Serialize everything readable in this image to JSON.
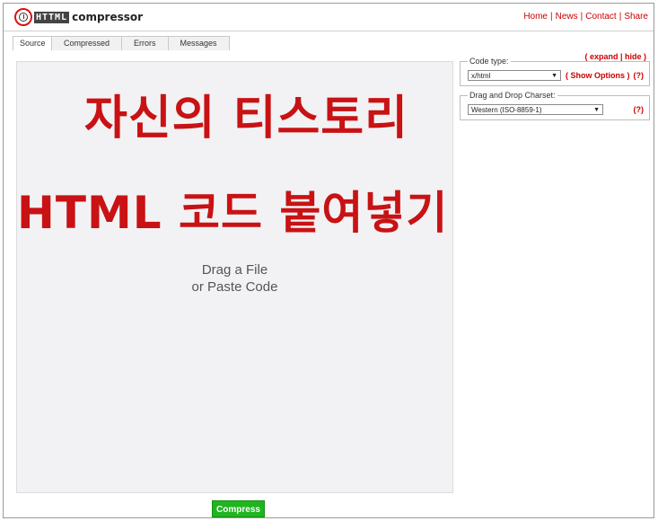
{
  "header": {
    "logo_mark": "HTTML",
    "logo_text": "compressor",
    "links": [
      "Home",
      "News",
      "Contact",
      "Share"
    ]
  },
  "tabs": [
    "Source",
    "Compressed",
    "Errors",
    "Messages"
  ],
  "source": {
    "overlay_line1": "자신의 티스토리",
    "overlay_line2": "HTML 코드 붙여넣기",
    "hint_line1": "Drag a File",
    "hint_line2": "or Paste Code"
  },
  "options": {
    "expand": "expand",
    "hide": "hide",
    "code_type_label": "Code type:",
    "code_type_value": "x/html",
    "show_options": "Show Options",
    "help": "(?)",
    "charset_label": "Drag and Drop Charset:",
    "charset_value": "Western (ISO-8859-1)"
  },
  "compress_label": "Compress",
  "colors": {
    "accent_red": "#cc0000",
    "overlay_red": "#c81214",
    "compress_green": "#1fb51f"
  }
}
